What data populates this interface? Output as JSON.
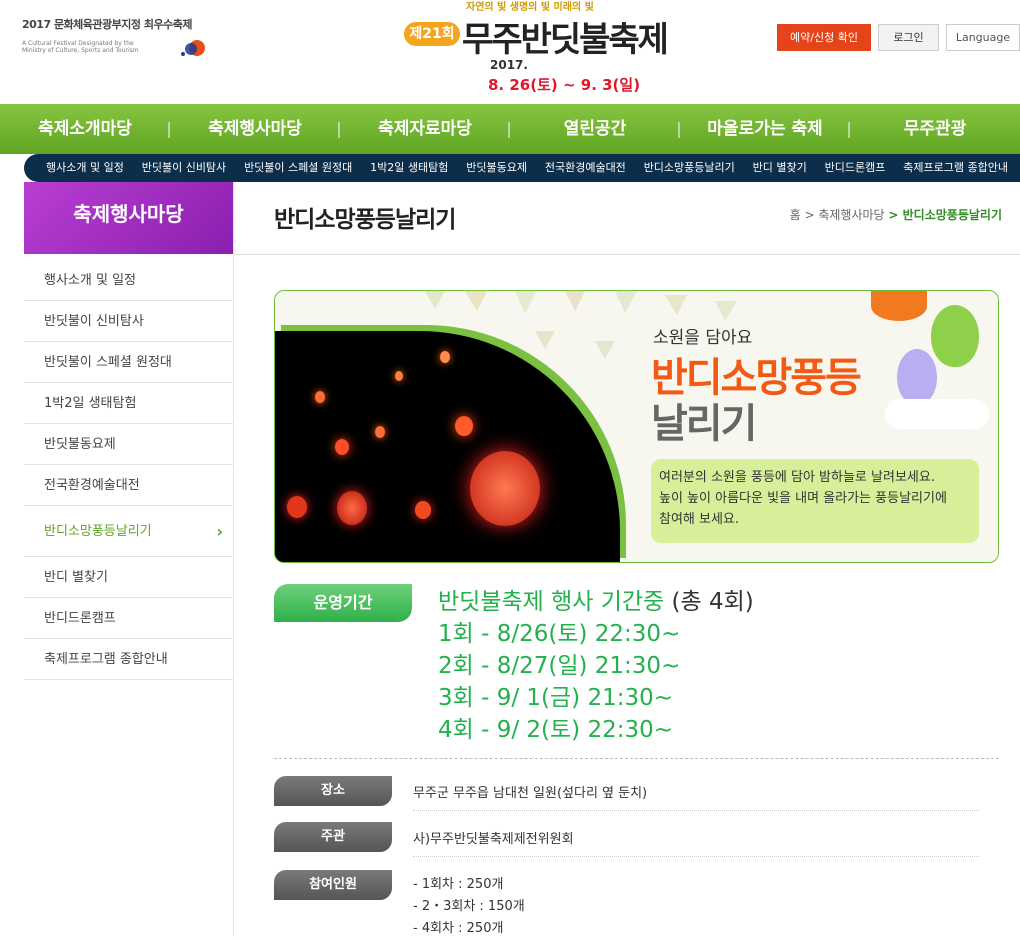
{
  "header": {
    "ministry_line1": "2017 문화체육관광부지정 최우수축제",
    "ministry_line2": "A Cultural Festival Designated by the Ministry of Culture, Sports and Tourism",
    "logo_tagline": "자연의 빛 생명의 빛 미래의 빛",
    "logo_badge": "제21회",
    "logo_title": "무주반딧불축제",
    "logo_year": "2017.",
    "logo_dates": "8. 26(토) ~ 9. 3(일)",
    "btn_reserve": "예약/신청 확인",
    "btn_login": "로그인",
    "btn_language": "Language"
  },
  "gnb": [
    "축제소개마당",
    "축제행사마당",
    "축제자료마당",
    "열린공간",
    "마을로가는 축제",
    "무주관광"
  ],
  "subnav": [
    "행사소개 및 일정",
    "반딧불이 신비탐사",
    "반딧불이 스페셜 원정대",
    "1박2일 생태탐험",
    "반딧불동요제",
    "전국환경예술대전",
    "반디소망풍등날리기",
    "반디 별찾기",
    "반디드론캠프",
    "축제프로그램 종합안내"
  ],
  "lnb": {
    "title": "축제행사마당",
    "items": [
      "행사소개 및 일정",
      "반딧불이 신비탐사",
      "반딧불이 스페셜 원정대",
      "1박2일 생태탐험",
      "반딧불동요제",
      "전국환경예술대전",
      "반디소망풍등날리기",
      "반디 별찾기",
      "반디드론캠프",
      "축제프로그램 종합안내"
    ],
    "active_index": 6
  },
  "page": {
    "title": "반디소망풍등날리기",
    "breadcrumb": [
      "홈",
      "> 축제행사마당",
      "> 반디소망풍등날리기"
    ]
  },
  "banner": {
    "subtitle": "소원을 담아요",
    "title_line1": "반디소망풍등",
    "title_line2": "날리기",
    "desc1": "여러분의 소원을 풍등에 담아 밤하늘로 날려보세요.",
    "desc2": "높이 높이 아름다운 빛을 내며 올라가는 풍등날리기에",
    "desc3": "참여해 보세요."
  },
  "period": {
    "label": "운영기간",
    "headline": "반딧불축제 행사 기간중 ",
    "total": "(총 4회)",
    "sessions": [
      "1회 - 8/26(토) 22:30~",
      "2회 - 8/27(일) 21:30~",
      "3회 - 9/ 1(금) 21:30~",
      "4회 - 9/ 2(토) 22:30~"
    ]
  },
  "info": {
    "place_label": "장소",
    "place_value": "무주군 무주읍 남대천 일원(섶다리 옆 둔치)",
    "host_label": "주관",
    "host_value": "사)무주반딧불축제제전위원회",
    "people_label": "참여인원",
    "people_values": [
      "- 1회차 : 250개",
      "- 2・3회차 : 150개",
      "- 4회차 : 250개"
    ]
  },
  "colors": {
    "green": "#5fa523",
    "navy": "#0d2e4a",
    "purple": "#9b2fc2",
    "orange": "#f25a14",
    "session_green": "#22b14c"
  }
}
